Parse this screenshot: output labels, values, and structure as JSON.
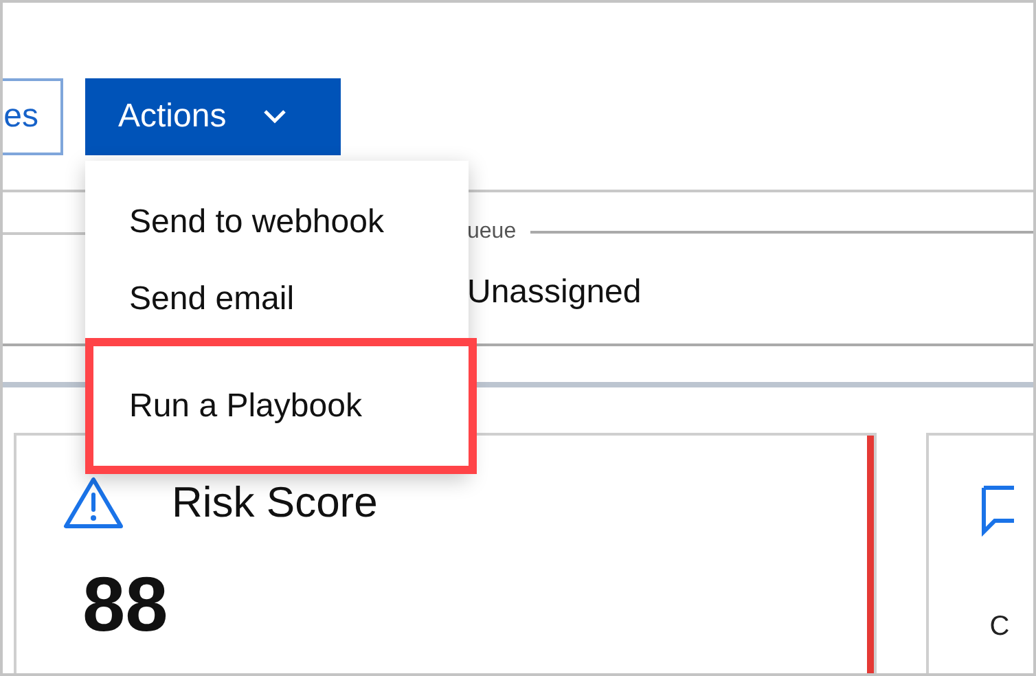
{
  "toolbar": {
    "buttons": [
      {
        "label": "es",
        "kind": "outline"
      },
      {
        "label": "Actions",
        "kind": "primary"
      }
    ]
  },
  "actions_menu": {
    "items": [
      {
        "label": "Send to webhook",
        "highlighted": false
      },
      {
        "label": "Send email",
        "highlighted": false
      },
      {
        "label": "Run a Playbook",
        "highlighted": true
      }
    ]
  },
  "queue_field": {
    "label": "ueue",
    "value": "Unassigned"
  },
  "cards": [
    {
      "kind": "risk",
      "title": "Risk Score",
      "value": "88",
      "color": "#e53935"
    },
    {
      "kind": "comments",
      "text": "C"
    }
  ]
}
